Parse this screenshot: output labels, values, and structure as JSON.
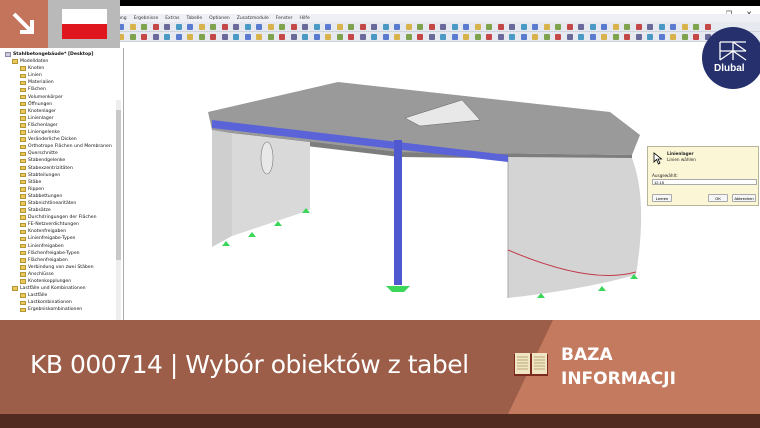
{
  "window": {
    "minimize": "–",
    "maximize": "❐",
    "close": "✕"
  },
  "menu": [
    "ung",
    "Ergebnisse",
    "Extras",
    "Tabelle",
    "Optionen",
    "Zusatzmodule",
    "Fenster",
    "Hilfe"
  ],
  "tree": {
    "root": "Stahlbetongebäude* [Desktop]",
    "items": [
      {
        "label": "Modelldaten",
        "level": 1
      },
      {
        "label": "Knoten",
        "level": 2
      },
      {
        "label": "Linien",
        "level": 2
      },
      {
        "label": "Materialien",
        "level": 2
      },
      {
        "label": "Flächen",
        "level": 2
      },
      {
        "label": "Volumenkörper",
        "level": 2
      },
      {
        "label": "Öffnungen",
        "level": 2
      },
      {
        "label": "Knotenlager",
        "level": 2
      },
      {
        "label": "Linienlager",
        "level": 2
      },
      {
        "label": "Flächenlager",
        "level": 2
      },
      {
        "label": "Liniengelenke",
        "level": 2
      },
      {
        "label": "Veränderliche Dicken",
        "level": 2
      },
      {
        "label": "Orthotrope Flächen und Membranen",
        "level": 2
      },
      {
        "label": "Querschnitte",
        "level": 2
      },
      {
        "label": "Stabendgelenke",
        "level": 2
      },
      {
        "label": "Stabexzentrizitäten",
        "level": 2
      },
      {
        "label": "Stabteilungen",
        "level": 2
      },
      {
        "label": "Stäbe",
        "level": 2
      },
      {
        "label": "Rippen",
        "level": 2
      },
      {
        "label": "Stabbettungen",
        "level": 2
      },
      {
        "label": "Stabnichtlinearitäten",
        "level": 2
      },
      {
        "label": "Stabsätze",
        "level": 2
      },
      {
        "label": "Durchdringungen der Flächen",
        "level": 2
      },
      {
        "label": "FE-Netzverdichtungen",
        "level": 2
      },
      {
        "label": "Knotenfreigaben",
        "level": 2
      },
      {
        "label": "Linienfreigabe-Typen",
        "level": 2
      },
      {
        "label": "Linienfreigaben",
        "level": 2
      },
      {
        "label": "Flächenfreigabe-Typen",
        "level": 2
      },
      {
        "label": "Flächenfreigaben",
        "level": 2
      },
      {
        "label": "Verbindung von zwei Stäben",
        "level": 2
      },
      {
        "label": "Anschlüsse",
        "level": 2
      },
      {
        "label": "Knotenkopplungen",
        "level": 2
      },
      {
        "label": "Lastfälle und Kombinationen",
        "level": 1
      },
      {
        "label": "Lastfälle",
        "level": 2
      },
      {
        "label": "Lastkombinationen",
        "level": 2
      },
      {
        "label": "Ergebniskombinationen",
        "level": 2
      }
    ]
  },
  "dialog": {
    "title": "Linienlager",
    "subtitle": "Linien wählen",
    "selected_label": "Ausgewählt:",
    "selected_value": "12,15",
    "clear": "Leeren",
    "ok": "OK",
    "cancel": "Abbrechen"
  },
  "logo": "Dlubal",
  "banner": {
    "title": "KB 000714 | Wybór obiektów z tabel",
    "kb_line1": "BAZA",
    "kb_line2": "INFORMACJI"
  },
  "colors": {
    "banner": "#9c5e48",
    "banner_accent": "#c47a5e",
    "footer": "#522b20",
    "logo": "#25306c",
    "flag_red": "#e0161f"
  }
}
